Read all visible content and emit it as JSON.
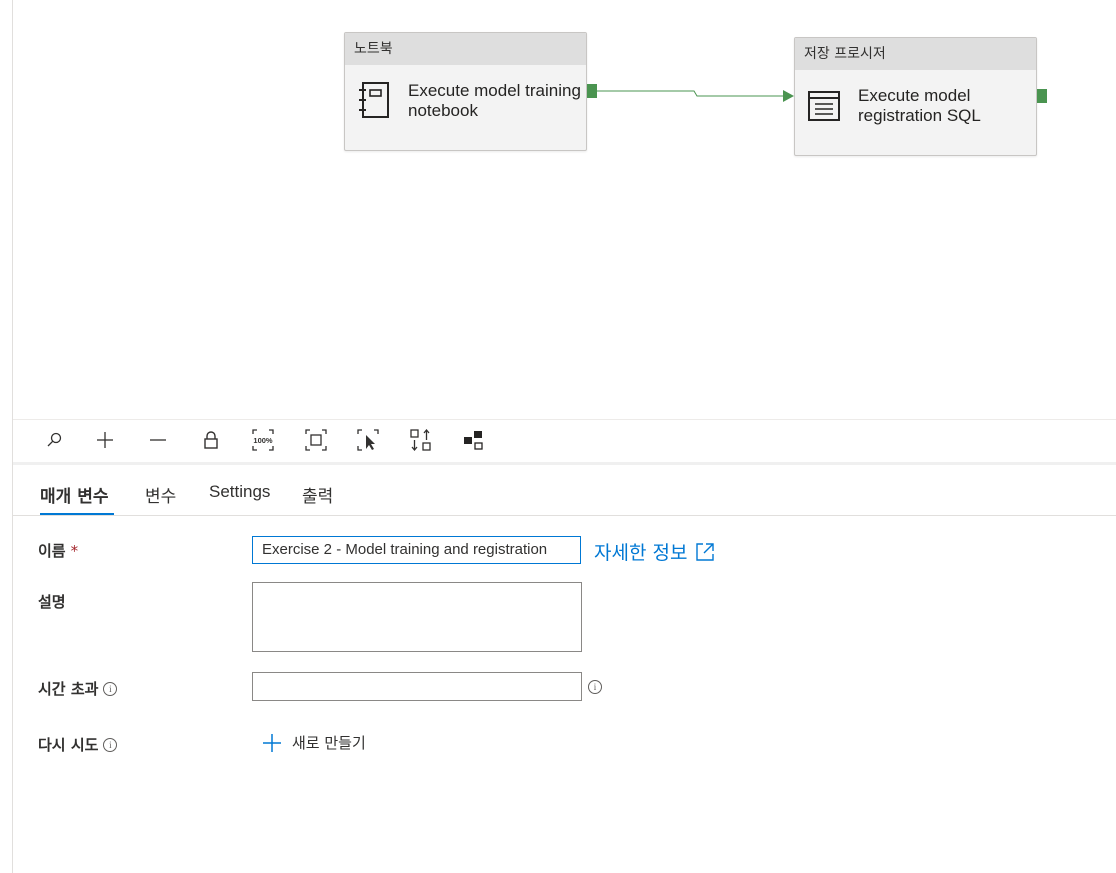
{
  "canvas": {
    "nodes": [
      {
        "category": "노트북",
        "title_line1": "Execute model training",
        "title_line2": "notebook",
        "icon": "notebook-icon"
      },
      {
        "category": "저장 프로시저",
        "title_line1": "Execute model",
        "title_line2": "registration SQL",
        "icon": "stored-procedure-icon"
      }
    ],
    "connector_color": "#4a9450"
  },
  "toolbar": {
    "buttons": [
      "search-icon",
      "zoom-in-icon",
      "zoom-out-icon",
      "lock-icon",
      "zoom-100-icon",
      "fit-to-window-icon",
      "select-icon",
      "auto-align-icon",
      "layout-icon"
    ],
    "zoom_label": "100%"
  },
  "tabs": [
    "매개 변수",
    "변수",
    "Settings",
    "출력"
  ],
  "form": {
    "name_label": "이름",
    "required_mark": "*",
    "name_value": "Exercise 2 - Model training and registration",
    "learn_more": "자세한 정보",
    "description_label": "설명",
    "description_value": "",
    "timeout_label": "시간 초과",
    "timeout_value": "",
    "retry_label": "다시 시도",
    "new_button": "새로 만들기"
  },
  "colors": {
    "accent": "#0078d4",
    "activity_success": "#4a9450"
  }
}
